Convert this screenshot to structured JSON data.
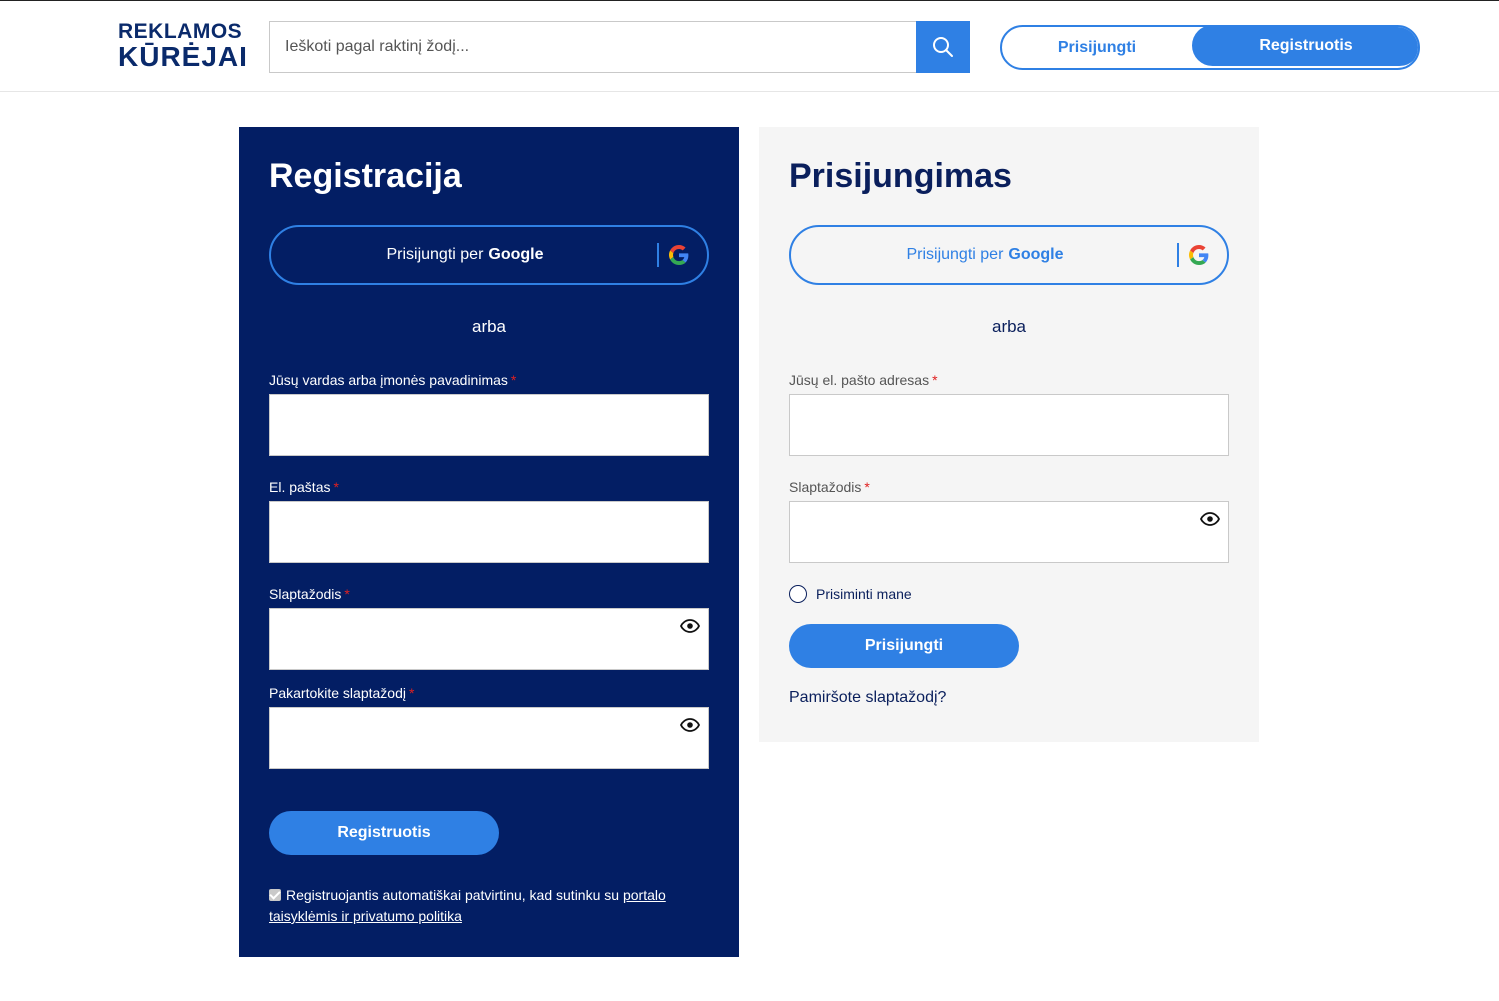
{
  "header": {
    "logo_line1": "REKLAMOS",
    "logo_line2": "KŪRĖJAI",
    "search_placeholder": "Ieškoti pagal raktinį žodį...",
    "login_label": "Prisijungti",
    "register_label": "Registruotis",
    "accent_color": "#2f80e4"
  },
  "register": {
    "title": "Registracija",
    "google_prefix": "Prisijungti per",
    "google_brand": "Google",
    "or": "arba",
    "name_label": "Jūsų vardas arba įmonės pavadinimas",
    "email_label": "El. paštas",
    "password_label": "Slaptažodis",
    "repeat_password_label": "Pakartokite slaptažodį",
    "required_mark": "*",
    "submit_label": "Registruotis",
    "consent_text": "Registruojantis automatiškai patvirtinu, kad sutinku su",
    "consent_link": "portalo taisyklėmis ir privatumo politika",
    "background_color": "#031e64"
  },
  "login": {
    "title": "Prisijungimas",
    "google_prefix": "Prisijungti per",
    "google_brand": "Google",
    "or": "arba",
    "email_label": "Jūsų el. pašto adresas",
    "password_label": "Slaptažodis",
    "required_mark": "*",
    "remember_label": "Prisiminti mane",
    "submit_label": "Prisijungti",
    "forgot_label": "Pamiršote slaptažodį?"
  }
}
